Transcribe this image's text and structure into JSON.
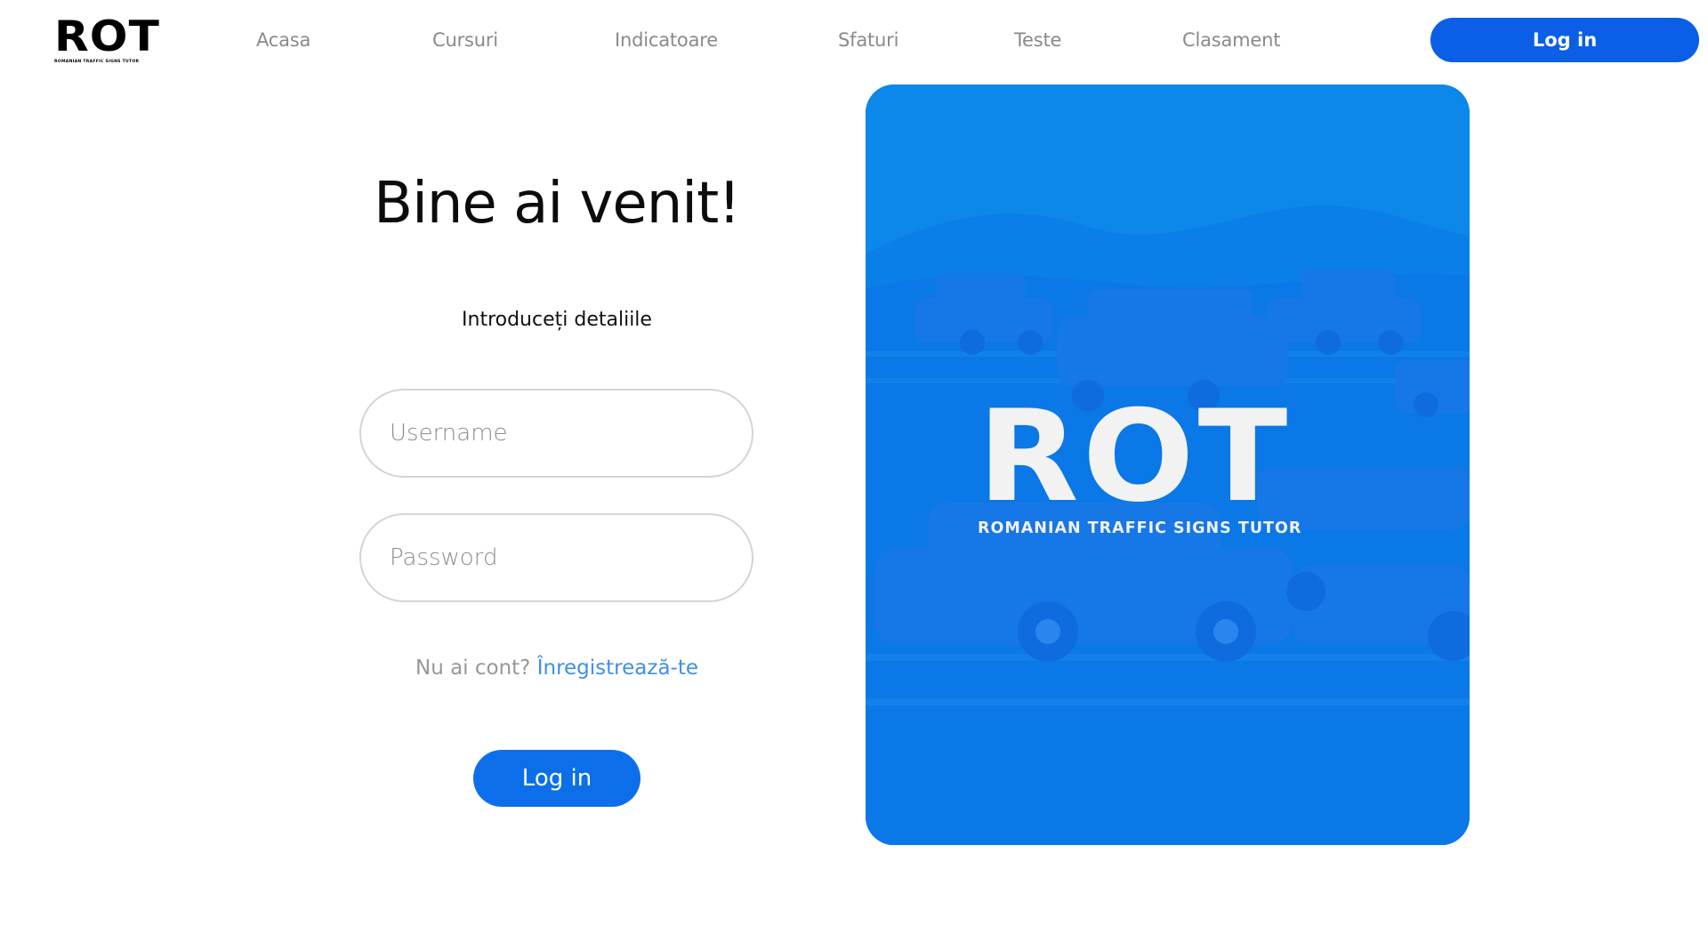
{
  "header": {
    "logo_text": "ROT",
    "logo_subtext": "ROMANIAN TRAFFIC SIGNS TUTOR",
    "nav": [
      {
        "label": "Acasa"
      },
      {
        "label": "Cursuri"
      },
      {
        "label": "Indicatoare"
      },
      {
        "label": "Sfaturi"
      },
      {
        "label": "Teste"
      },
      {
        "label": "Clasament"
      }
    ],
    "login_label": "Log in"
  },
  "form": {
    "title": "Bine ai venit!",
    "subtitle": "Introduceți detaliile",
    "username_placeholder": "Username",
    "password_placeholder": "Password",
    "no_account_text": "Nu ai cont?",
    "register_link": "Înregistrează-te",
    "submit_label": "Log in"
  },
  "hero": {
    "logo_text": "ROT",
    "logo_subtext": "ROMANIAN TRAFFIC SIGNS TUTOR"
  },
  "colors": {
    "primary": "#0a5fe6",
    "hero_background": "#0c87ea",
    "link": "#3f8fe6"
  }
}
